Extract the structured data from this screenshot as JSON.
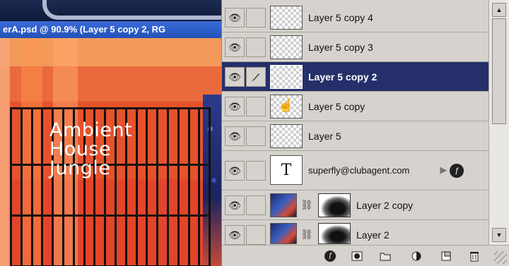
{
  "document": {
    "title": "erA.psd @ 90.9% (Layer 5 copy 2, RG",
    "artwork_lines": [
      "Ambient",
      "House",
      "Jungle"
    ]
  },
  "layers_panel": {
    "layers": [
      {
        "name": "Layer 5 copy 4",
        "selected": false,
        "thumb": "transparent"
      },
      {
        "name": "Layer 5 copy 3",
        "selected": false,
        "thumb": "transparent"
      },
      {
        "name": "Layer 5 copy 2",
        "selected": true,
        "thumb": "transparent"
      },
      {
        "name": "Layer 5 copy",
        "selected": false,
        "thumb": "transparent"
      },
      {
        "name": "Layer 5",
        "selected": false,
        "thumb": "transparent"
      },
      {
        "name": "superfly@clubagent.com",
        "selected": false,
        "thumb": "type",
        "thumb_glyph": "T"
      },
      {
        "name": "Layer 2 copy",
        "selected": false,
        "thumb": "photo-with-mask"
      },
      {
        "name": "Layer 2",
        "selected": false,
        "thumb": "photo-with-mask"
      }
    ],
    "icons": {
      "visibility": "eye-icon",
      "brush": "brush-icon",
      "chain": "chain-link-icon",
      "effects": "layer-effects-icon"
    },
    "toolbar_icons": [
      "add-layer-style-icon",
      "add-mask-icon",
      "new-group-folder-icon",
      "adjustment-layer-icon",
      "new-layer-icon",
      "trash-icon"
    ],
    "fx_glyph": "ƒ",
    "colors": {
      "panel_bg": "#d6d3ce",
      "selected_row": "#25306a",
      "title_bar": "#2353b8"
    }
  }
}
